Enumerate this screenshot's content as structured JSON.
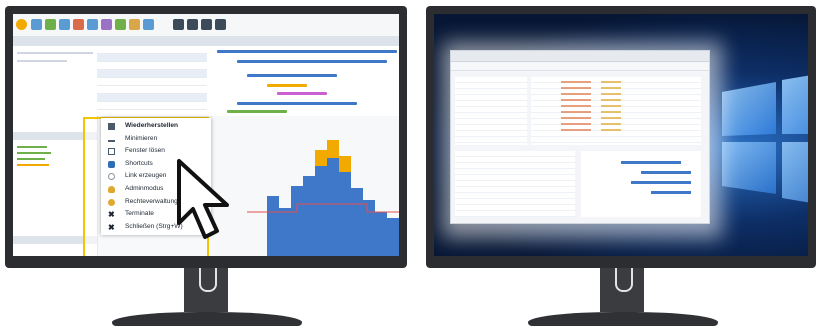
{
  "context_menu": {
    "items": [
      {
        "label": "Wiederherstellen",
        "icon": "restore-icon",
        "bold": true
      },
      {
        "label": "Minimieren",
        "icon": "minimize-icon",
        "bold": false
      },
      {
        "label": "Fenster lösen",
        "icon": "detach-window-icon",
        "bold": false
      },
      {
        "label": "Shortcuts",
        "icon": "shortcuts-icon",
        "bold": false
      },
      {
        "label": "Link erzeugen",
        "icon": "link-icon",
        "bold": false
      },
      {
        "label": "Adminmodus",
        "icon": "admin-key-icon",
        "bold": false
      },
      {
        "label": "Rechteverwaltung",
        "icon": "rights-icon",
        "bold": false
      },
      {
        "label": "Terminate",
        "icon": "terminate-icon",
        "bold": false
      },
      {
        "label": "Schließen (Strg+W)",
        "icon": "close-icon",
        "bold": false
      }
    ]
  },
  "colors": {
    "highlight": "#f2c500",
    "monitor_frame": "#2b2d30",
    "bar_blue": "#3f78c9",
    "bar_orange": "#f2a900",
    "desktop_blue": "#0d2e66"
  }
}
